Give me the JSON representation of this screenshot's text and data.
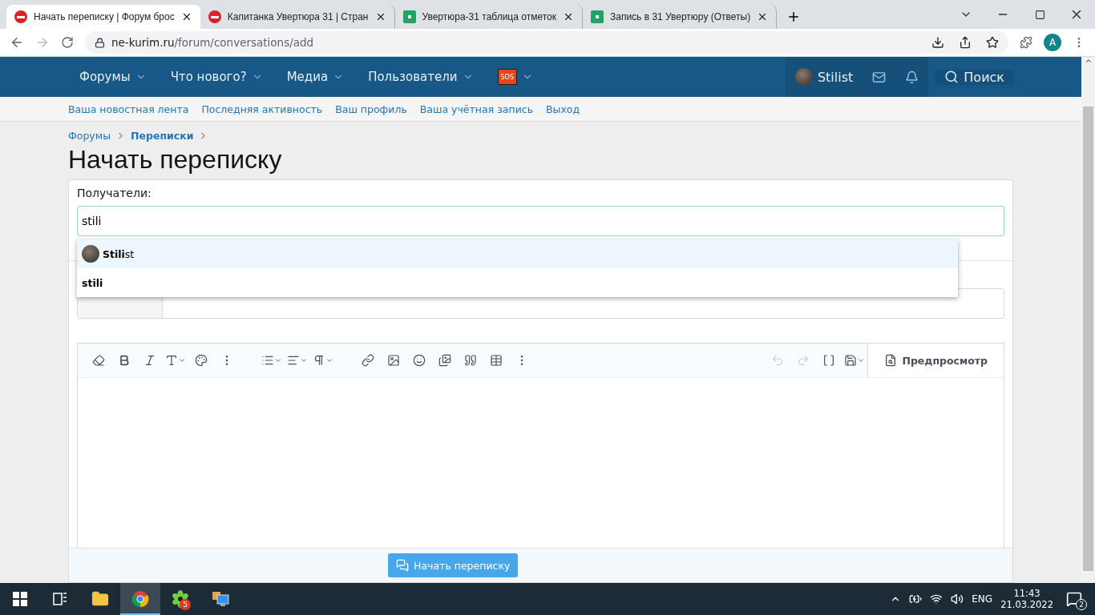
{
  "browser": {
    "tabs": [
      {
        "title": "Начать переписку | Форум брос",
        "kind": "forum",
        "selected": true
      },
      {
        "title": "Капитанка Увертюра 31 | Стран",
        "kind": "forum",
        "selected": false
      },
      {
        "title": "Увертюра-31 таблица отметок",
        "kind": "sheet",
        "selected": false
      },
      {
        "title": "Запись в 31 Увертюру (Ответы)",
        "kind": "sheet",
        "selected": false
      }
    ],
    "url_host": "ne-kurim.ru",
    "url_path": "/forum/conversations/add",
    "profile_letter": "A"
  },
  "nav": {
    "items": [
      {
        "label": "Форумы",
        "kind": "text"
      },
      {
        "label": "Что нового?",
        "kind": "text"
      },
      {
        "label": "Медиа",
        "kind": "text"
      },
      {
        "label": "Пользователи",
        "kind": "text"
      },
      {
        "label": "SOS",
        "kind": "badge"
      }
    ],
    "user": "Stilist",
    "search": "Поиск"
  },
  "subnav": [
    "Ваша новостная лента",
    "Последняя активность",
    "Ваш профиль",
    "Ваша учётная запись",
    "Выход"
  ],
  "breadcrumbs": [
    {
      "label": "Форумы",
      "current": false
    },
    {
      "label": "Переписки",
      "current": true
    }
  ],
  "page_title": "Начать переписку",
  "form": {
    "recipients_label": "Получатели:",
    "recipients_value": "stili",
    "suggestions": [
      {
        "text": "**Stili**st",
        "avatar": true,
        "selected": true
      },
      {
        "text": "stili",
        "avatar": false,
        "selected": false
      }
    ],
    "toolbar": [
      {
        "kind": "eraser",
        "disabled": false
      },
      {
        "kind": "bold",
        "disabled": false
      },
      {
        "kind": "italic",
        "disabled": false
      },
      {
        "kind": "size",
        "disabled": false
      },
      {
        "kind": "palette",
        "disabled": false
      },
      {
        "kind": "more",
        "disabled": false
      },
      {
        "kind": "gap"
      },
      {
        "kind": "list",
        "disabled": false
      },
      {
        "kind": "align",
        "disabled": false
      },
      {
        "kind": "paragraph",
        "disabled": false
      },
      {
        "kind": "gap"
      },
      {
        "kind": "link",
        "disabled": false
      },
      {
        "kind": "image",
        "disabled": false
      },
      {
        "kind": "smile",
        "disabled": false
      },
      {
        "kind": "media",
        "disabled": false
      },
      {
        "kind": "quote",
        "disabled": false
      },
      {
        "kind": "table",
        "disabled": false
      },
      {
        "kind": "more",
        "disabled": false
      },
      {
        "kind": "spacer"
      },
      {
        "kind": "undo",
        "disabled": true
      },
      {
        "kind": "redo",
        "disabled": true
      },
      {
        "kind": "brackets",
        "disabled": false
      },
      {
        "kind": "save",
        "disabled": false
      }
    ],
    "preview": "Предпросмотр",
    "submit": "Начать переписку"
  },
  "taskbar": {
    "apps": [
      {
        "kind": "taskview",
        "selected": false
      },
      {
        "kind": "folder",
        "selected": false
      },
      {
        "kind": "chrome",
        "selected": true
      },
      {
        "kind": "icq",
        "selected": false,
        "badge": "5"
      },
      {
        "kind": "rdp",
        "selected": false
      }
    ],
    "lang": "ENG",
    "time": "11:43",
    "date": "21.03.2022",
    "notifications": "2"
  }
}
